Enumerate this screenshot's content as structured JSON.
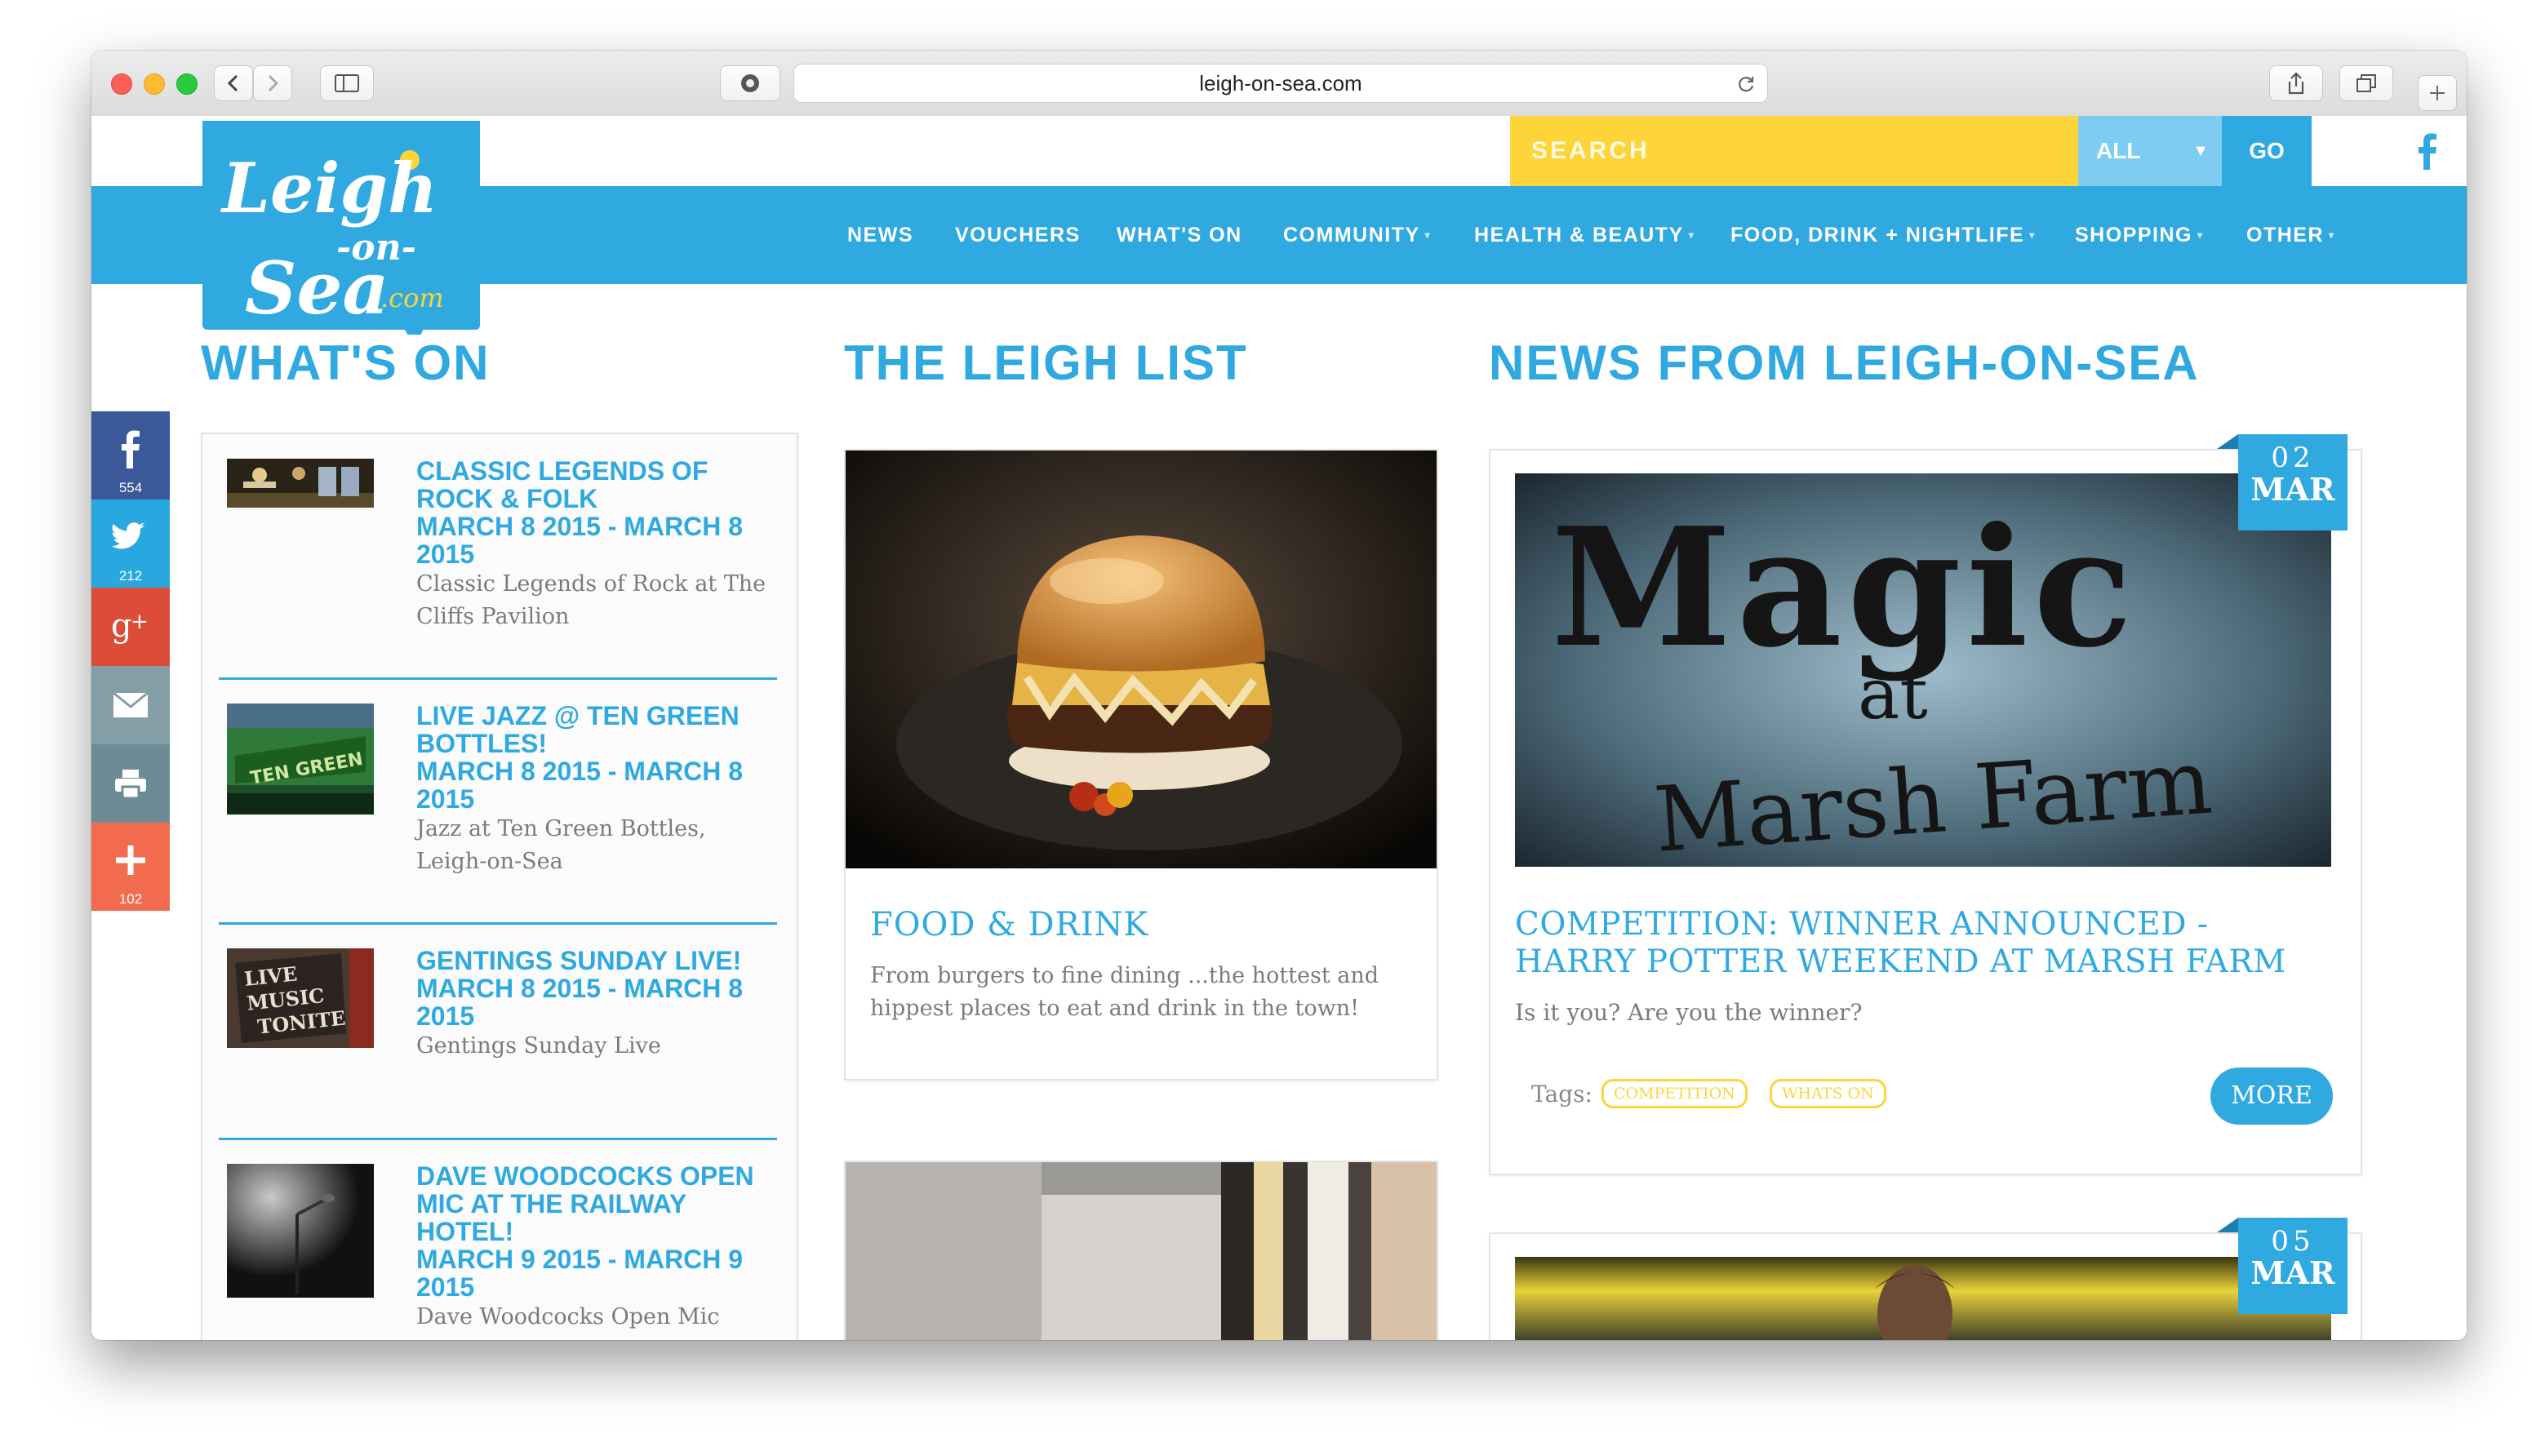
{
  "browser": {
    "url": "leigh-on-sea.com"
  },
  "site": {
    "logo": {
      "line1": "Leigh",
      "line2": "-on-",
      "line3": "Sea",
      "line4": ".com"
    },
    "search": {
      "placeholder": "SEARCH",
      "filter": "ALL",
      "go": "GO"
    },
    "nav": [
      "NEWS",
      "VOUCHERS",
      "WHAT'S ON",
      "COMMUNITY",
      "HEALTH & BEAUTY",
      "FOOD, DRINK + NIGHTLIFE",
      "SHOPPING",
      "OTHER"
    ]
  },
  "share_counts": {
    "facebook": "554",
    "twitter": "212",
    "plus": "102"
  },
  "whats_on": {
    "title": "WHAT'S ON",
    "events": [
      {
        "title": "CLASSIC LEGENDS OF ROCK & FOLK",
        "dates": "MARCH 8 2015 - MARCH 8 2015",
        "desc": "Classic Legends of Rock at The Cliffs Pavilion"
      },
      {
        "title": "LIVE JAZZ @ TEN GREEN BOTTLES!",
        "dates": "MARCH 8 2015 - MARCH 8 2015",
        "desc": "Jazz at Ten Green Bottles, Leigh-on-Sea"
      },
      {
        "title": "GENTINGS SUNDAY LIVE!",
        "dates": "MARCH 8 2015 - MARCH 8 2015",
        "desc": "Gentings Sunday Live"
      },
      {
        "title": "DAVE WOODCOCKS OPEN MIC AT THE RAILWAY HOTEL!",
        "dates": "MARCH 9 2015 - MARCH 9 2015",
        "desc": "Dave Woodcocks Open Mic"
      }
    ],
    "image_text": {
      "ten_green": "TEN GREEN",
      "live_music": "LIVE MUSIC TONITE"
    }
  },
  "leigh_list": {
    "title": "THE LEIGH LIST",
    "card": {
      "title": "FOOD & DRINK",
      "desc": "From burgers to fine dining ...the hottest and hippest places to eat and drink in the town!"
    }
  },
  "news": {
    "title": "NEWS FROM LEIGH-ON-SEA",
    "articles": [
      {
        "day": "02",
        "month": "MAR",
        "image_text": {
          "line1": "Magic",
          "line2": "at",
          "line3": "Marsh Farm"
        },
        "title": "COMPETITION: WINNER ANNOUNCED - HARRY POTTER WEEKEND AT MARSH FARM",
        "desc": "Is it you? Are you the winner?",
        "tags_label": "Tags:",
        "tags": [
          "COMPETITION",
          "WHATS ON"
        ],
        "more": "MORE"
      },
      {
        "day": "05",
        "month": "MAR"
      }
    ]
  },
  "colors": {
    "brand_blue": "#2fa9e0",
    "brand_yellow": "#fdd53a"
  }
}
